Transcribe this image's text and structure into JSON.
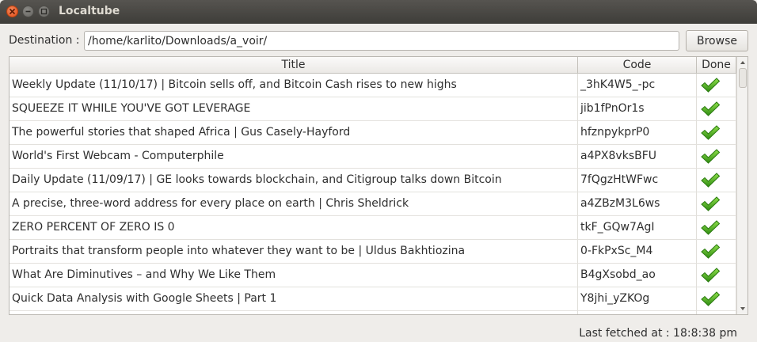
{
  "window": {
    "title": "Localtube"
  },
  "destination": {
    "label": "Destination :",
    "value": "/home/karlito/Downloads/a_voir/"
  },
  "browse_label": "Browse",
  "table": {
    "columns": [
      "Title",
      "Code",
      "Done"
    ],
    "rows": [
      {
        "title": "Weekly Update (11/10/17) | Bitcoin sells off, and Bitcoin Cash rises to new highs",
        "code": "_3hK4W5_-pc",
        "done": true
      },
      {
        "title": "SQUEEZE IT WHILE YOU'VE GOT LEVERAGE",
        "code": "jib1fPnOr1s",
        "done": true
      },
      {
        "title": "The powerful stories that shaped Africa | Gus Casely-Hayford",
        "code": "hfznpykprP0",
        "done": true
      },
      {
        "title": "World's First Webcam - Computerphile",
        "code": "a4PX8vksBFU",
        "done": true
      },
      {
        "title": "Daily Update (11/09/17) | GE looks towards blockchain, and Citigroup talks down Bitcoin",
        "code": "7fQgzHtWFwc",
        "done": true
      },
      {
        "title": "A precise, three-word address for every place on earth | Chris Sheldrick",
        "code": "a4ZBzM3L6ws",
        "done": true
      },
      {
        "title": "ZERO PERCENT OF ZERO IS 0",
        "code": "tkF_GQw7AgI",
        "done": true
      },
      {
        "title": "Portraits that transform people into whatever they want to be | Uldus Bakhtiozina",
        "code": "0-FkPxSc_M4",
        "done": true
      },
      {
        "title": "What Are Diminutives – and Why We Like Them",
        "code": "B4gXsobd_ao",
        "done": true
      },
      {
        "title": "Quick Data Analysis with Google Sheets | Part 1",
        "code": "Y8jhi_yZKOg",
        "done": true
      }
    ]
  },
  "status": {
    "text": "Last fetched at : 18:8:38 pm"
  },
  "icons": {
    "done": "green-checkmark-icon"
  },
  "colors": {
    "titlebar": "#3e3d39",
    "close_button": "#df4a16",
    "check": "#3ea11a"
  }
}
